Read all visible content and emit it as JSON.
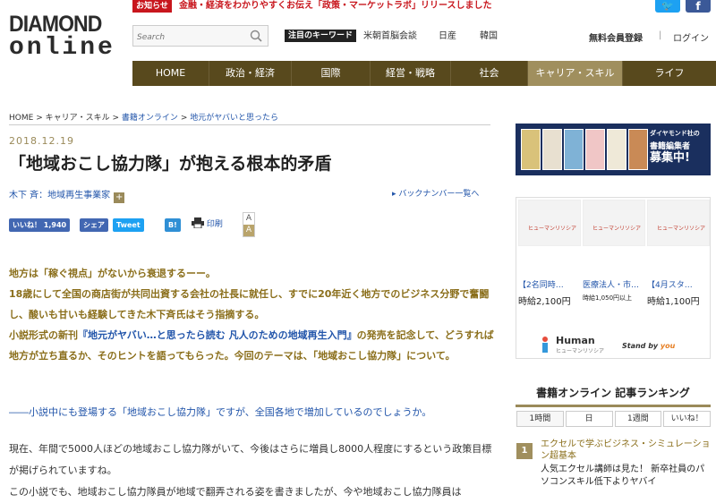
{
  "topbar": {
    "oshirase": "お知らせ",
    "news": "金融・経済をわかりやすくお伝え「政策・マーケットラボ」リリースしました"
  },
  "logo": {
    "line1": "DIAMOND",
    "line2": "online"
  },
  "search": {
    "placeholder": "Search"
  },
  "keywords": {
    "label": "注目のキーワード",
    "items": [
      "米朝首脳会談",
      "日産",
      "韓国"
    ]
  },
  "account": {
    "register": "無料会員登録",
    "separator": "|",
    "login": "ログイン"
  },
  "nav": {
    "items": [
      "HOME",
      "政治・経済",
      "国際",
      "経営・戦略",
      "社会",
      "キャリア・スキル",
      "ライフ"
    ]
  },
  "breadcrumb": {
    "items": [
      "HOME",
      "キャリア・スキル",
      "書籍オンライン",
      "地元がヤバいと思ったら"
    ],
    "sep": ">"
  },
  "article": {
    "date": "2018.12.19",
    "title": "「地域おこし協力隊」が抱える根本的矛盾",
    "author": "木下 斉：地域再生事業家",
    "author_plus": "+",
    "back_numbers": "▸ バックナンバー一覧へ",
    "share": {
      "like": "いいね！ 1,940",
      "share": "シェア",
      "tweet": "Tweet",
      "hatena": "B!",
      "print": "印刷"
    },
    "font_size": {
      "small": "A",
      "large": "A"
    },
    "lead1": "地方は「稼ぐ視点」がないから衰退するーー。",
    "lead2": "18歳にして全国の商店街が共同出資する会社の社長に就任し、すでに20年近く地方でのビジネス分野で奮闘し、酸いも甘いも経験してきた木下斉氏はそう指摘する。",
    "lead3a": "小説形式の新刊",
    "lead3b": "『地元がヤバい…と思ったら読む 凡人のための地域再生入門』",
    "lead3c": "の発売を記念して、どうすれば地方が立ち直るか、そのヒントを語ってもらった。今回のテーマは、「地域おこし協力隊」について。",
    "question": "――小説中にも登場する「地域おこし協力隊」ですが、全国各地で増加しているのでしょうか。",
    "body1": "現在、年間で5000人ほどの地域おこし協力隊がいて、今後はさらに増員し8000人程度にするという政策目標が掲げられていますね。",
    "body2": "この小説でも、地域おこし協力隊員が地域で翻弄される姿を書きましたが、今や地域おこし協力隊員は"
  },
  "sidebar": {
    "banner": {
      "t1": "ダイヤモンド社の",
      "t2": "書籍編集者",
      "t3": "募集中!"
    },
    "ad": {
      "cards": [
        {
          "brand": "ヒューマンリソシア",
          "title": "【2名同時…",
          "price": "時給2,100円"
        },
        {
          "brand": "ヒューマンリソシア",
          "title": "医療法人・市…",
          "price": "時給1,050円以上"
        },
        {
          "brand": "ヒューマンリソシア",
          "title": "【4月スタ…",
          "price": "時給1,100円"
        }
      ],
      "logo_name": "Human",
      "logo_sub": "ヒューマンリソシア",
      "standby": "Stand by ",
      "standby_you": "you"
    },
    "ranking": {
      "title": "書籍オンライン 記事ランキング",
      "tabs": [
        "1時間",
        "日",
        "1週間",
        "いいね！"
      ],
      "first": {
        "num": "1",
        "category": "エクセルで学ぶビジネス・シミュレーション超基本",
        "title": "人気エクセル講師は見た！ 新卒社員のパソコンスキル低下よりヤバイ"
      }
    }
  },
  "colors": {
    "nav": "#58491d",
    "nav_active": "#a08f5e",
    "accent_red": "#c8161d",
    "link": "#2255aa",
    "gold_text": "#8a6e1a"
  }
}
